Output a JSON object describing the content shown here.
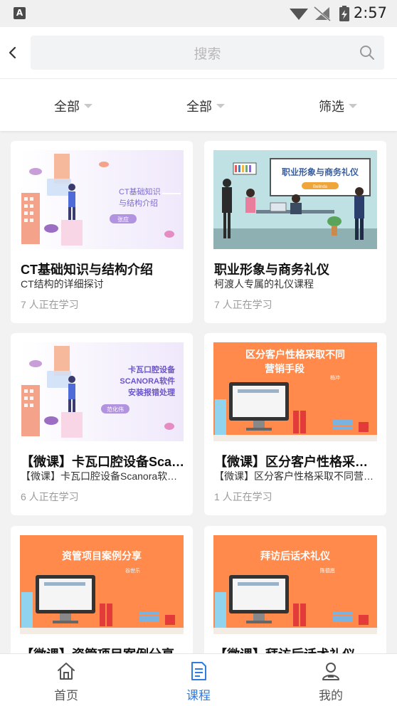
{
  "status_bar": {
    "time": "2:57",
    "notification_icon_letter": "A"
  },
  "search": {
    "placeholder": "搜索"
  },
  "filters": [
    {
      "label": "全部"
    },
    {
      "label": "全部"
    },
    {
      "label": "筛选"
    }
  ],
  "courses": [
    {
      "title": "CT基础知识与结构介绍",
      "subtitle": "CT结构的详细探讨",
      "learners": "7 人正在学习",
      "thumb": {
        "heading_lines": [
          "CT基础知识",
          "与结构介绍"
        ],
        "author": "张应"
      }
    },
    {
      "title": "职业形象与商务礼仪",
      "subtitle": "柯渡人专属的礼仪课程",
      "learners": "7 人正在学习",
      "thumb": {
        "heading": "职业形象与商务礼仪",
        "author": "Belinda"
      }
    },
    {
      "title": "【微课】卡瓦口腔设备Scanora软件安装报错处理",
      "subtitle": "【微课】卡瓦口腔设备Scanora软件安装报错处理",
      "learners": "6 人正在学习",
      "thumb": {
        "heading_lines": [
          "卡瓦口腔设备",
          "SCANORA软件",
          "安装报错处理"
        ],
        "author": "范化伟"
      }
    },
    {
      "title": "【微课】区分客户性格采取不同营销手段",
      "subtitle": "【微课】区分客户性格采取不同营销手段",
      "learners": "1 人正在学习",
      "thumb": {
        "heading_lines": [
          "区分客户性格采取不同",
          "营销手段"
        ],
        "author": "杨冲"
      }
    },
    {
      "title": "【微课】资管项目案例分享",
      "subtitle": "",
      "learners": "",
      "thumb": {
        "heading": "资管项目案例分享",
        "author": "谷世乐"
      }
    },
    {
      "title": "【微课】拜访后话术礼仪",
      "subtitle": "",
      "learners": "",
      "thumb": {
        "heading": "拜访后话术礼仪",
        "author": "陈德愿"
      }
    }
  ],
  "tabs": [
    {
      "label": "首页",
      "icon": "home-icon"
    },
    {
      "label": "课程",
      "icon": "course-icon",
      "active": true
    },
    {
      "label": "我的",
      "icon": "profile-icon"
    }
  ],
  "colors": {
    "accent": "#2f7be0",
    "orange": "#ff8a4c",
    "background": "#f2f2f2"
  }
}
